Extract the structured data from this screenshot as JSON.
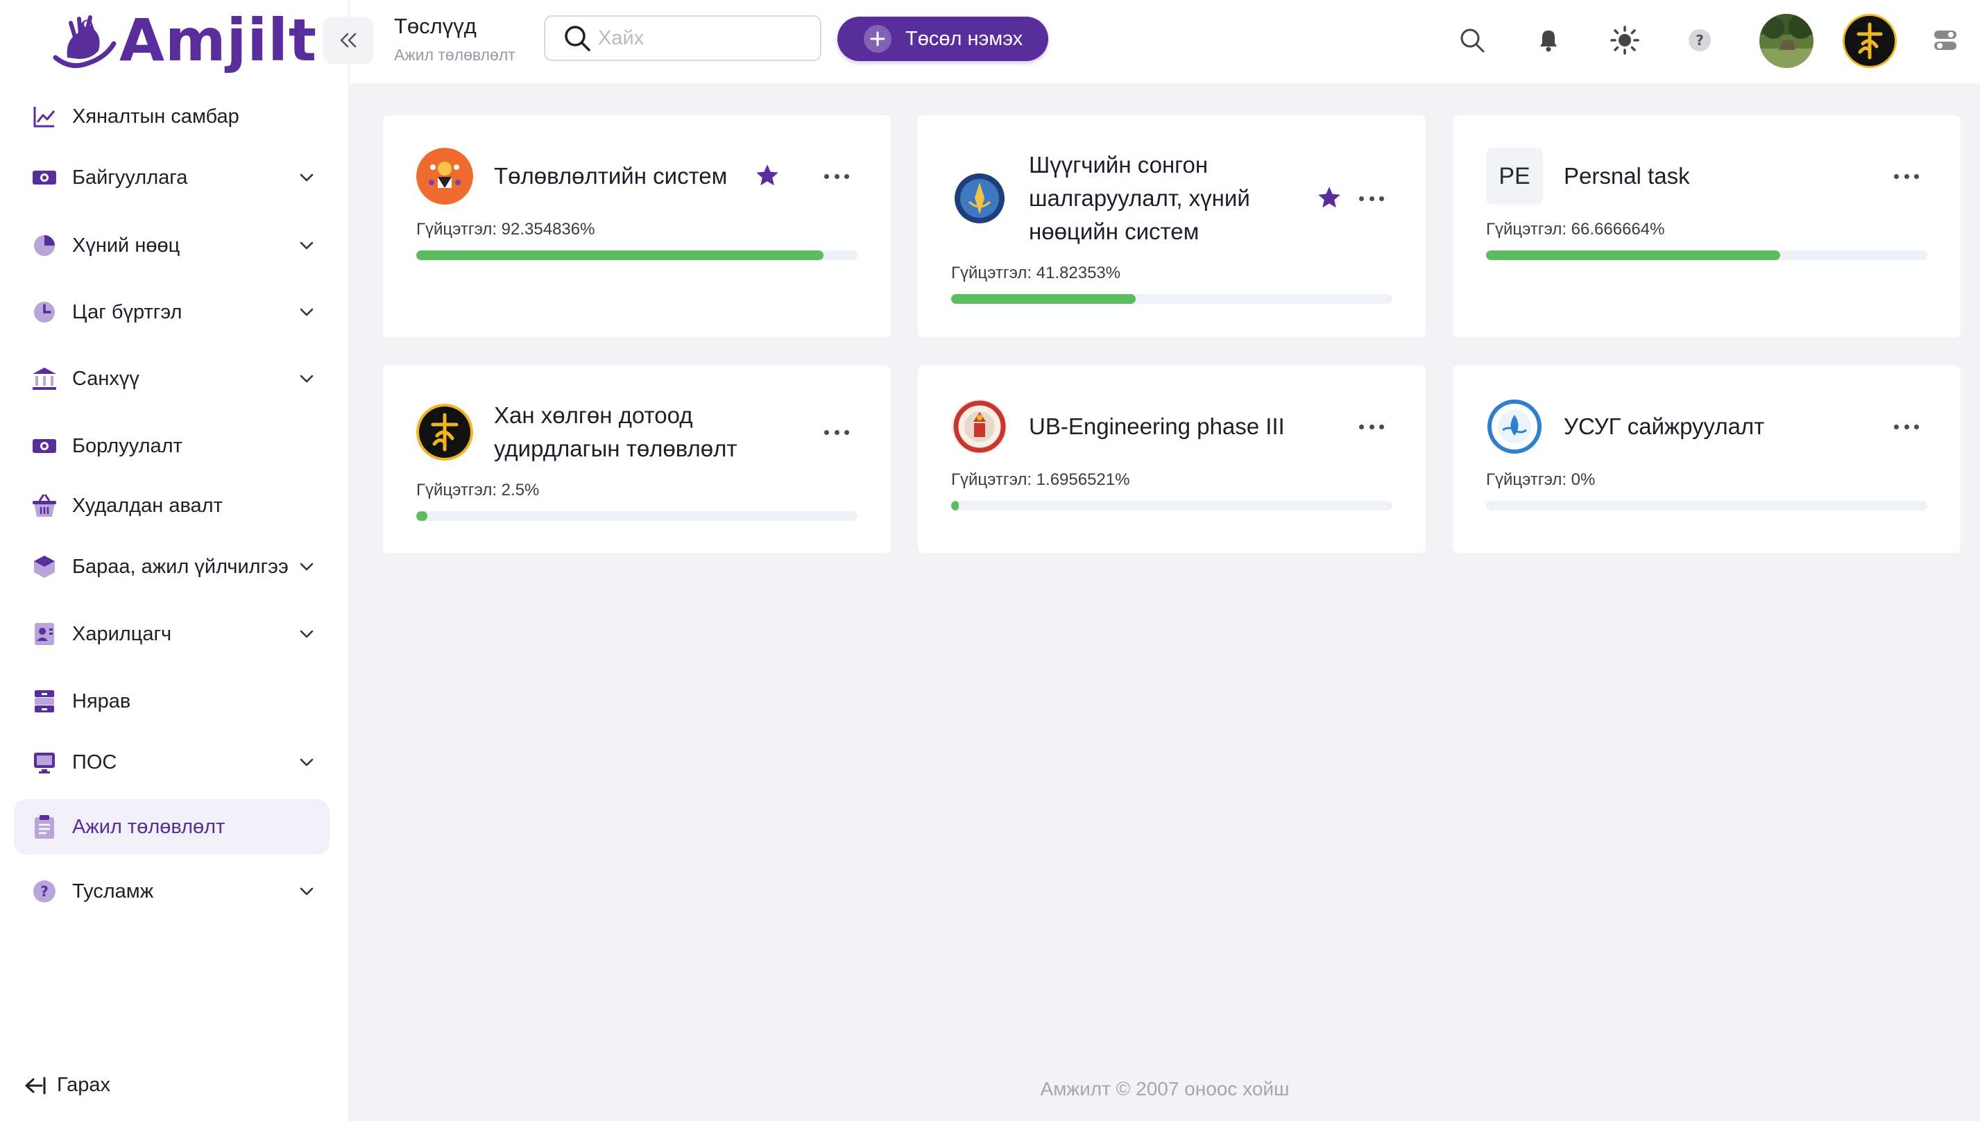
{
  "app": {
    "brand": "Amjilt"
  },
  "header": {
    "title": "Төслүүд",
    "subtitle": "Ажил төлөвлөлт",
    "search_placeholder": "Хайх",
    "add_button": "Төсөл нэмэх"
  },
  "sidebar": {
    "items": [
      {
        "label": "Хяналтын самбар",
        "icon": "chart-line-icon",
        "expandable": false,
        "active": false
      },
      {
        "label": "Байгууллага",
        "icon": "money-icon",
        "expandable": true,
        "active": false
      },
      {
        "label": "Хүний нөөц",
        "icon": "pie-chart-icon",
        "expandable": true,
        "active": false
      },
      {
        "label": "Цаг бүртгэл",
        "icon": "clock-icon",
        "expandable": true,
        "active": false
      },
      {
        "label": "Санхүү",
        "icon": "bank-icon",
        "expandable": true,
        "active": false
      },
      {
        "label": "Борлуулалт",
        "icon": "money-icon",
        "expandable": false,
        "active": false
      },
      {
        "label": "Худалдан авалт",
        "icon": "basket-icon",
        "expandable": false,
        "active": false
      },
      {
        "label": "Бараа, ажил үйлчилгээ",
        "icon": "cube-icon",
        "expandable": true,
        "active": false
      },
      {
        "label": "Харилцагч",
        "icon": "contact-card-icon",
        "expandable": true,
        "active": false
      },
      {
        "label": "Нярав",
        "icon": "archive-icon",
        "expandable": false,
        "active": false
      },
      {
        "label": "ПОС",
        "icon": "monitor-icon",
        "expandable": true,
        "active": false
      },
      {
        "label": "Ажил төлөвлөлт",
        "icon": "clipboard-icon",
        "expandable": false,
        "active": true
      },
      {
        "label": "Тусламж",
        "icon": "help-icon",
        "expandable": true,
        "active": false
      }
    ],
    "logout": "Гарах"
  },
  "projects": [
    {
      "title_lines": [
        "Төлөвлөлтийн систем"
      ],
      "progress_label": "Гүйцэтгэл: 92.354836%",
      "progress": 0.92354836,
      "starred": true,
      "logo": "orange-circle-logo"
    },
    {
      "title_lines": [
        "Шүүгчийн сонгон",
        "шалгаруулалт, хүний",
        "нөөцийн систем"
      ],
      "progress_label": "Гүйцэтгэл: 41.82353%",
      "progress": 0.4182353,
      "starred": true,
      "logo": "court-emblem-logo"
    },
    {
      "title_lines": [
        "Persnal task"
      ],
      "progress_label": "Гүйцэтгэл: 66.666664%",
      "progress": 0.66666664,
      "starred": false,
      "logo_text": "PE"
    },
    {
      "title_lines": [
        "Хан хөлгөн дотоод",
        "удирдлагын төлөвлөлт"
      ],
      "progress_label": "Гүйцэтгэл: 2.5%",
      "progress": 0.025,
      "starred": false,
      "logo": "black-gold-symbol-logo"
    },
    {
      "title_lines": [
        "UB-Engineering phase III"
      ],
      "progress_label": "Гүйцэтгэл: 1.6956521%",
      "progress": 0.016956521,
      "starred": false,
      "logo": "red-emblem-logo"
    },
    {
      "title_lines": [
        "УСУГ сайжруулалт"
      ],
      "progress_label": "Гүйцэтгэл: 0%",
      "progress": 0,
      "starred": false,
      "logo": "water-seal-logo"
    }
  ],
  "footer": "Амжилт © 2007 оноос хойш",
  "colors": {
    "accent": "#5a2d9c",
    "progress": "#5cbd60",
    "star": "#5a2d9c"
  }
}
